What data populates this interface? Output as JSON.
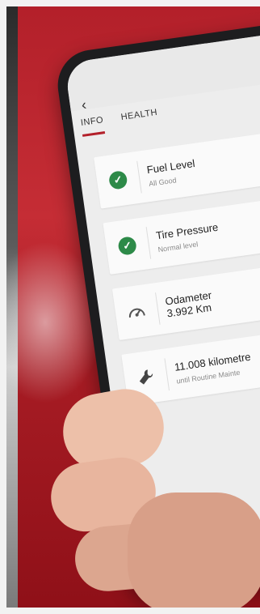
{
  "tabs": [
    {
      "label": "INFO",
      "active": true
    },
    {
      "label": "HEALTH",
      "active": false
    }
  ],
  "cards": [
    {
      "icon": "check-circle-icon",
      "title": "Fuel Level",
      "subtitle": "All Good"
    },
    {
      "icon": "check-circle-icon",
      "title": "Tire Pressure",
      "subtitle": "Normal level"
    },
    {
      "icon": "speedometer-icon",
      "title": "Odameter",
      "subtitle": "3.992 Km"
    },
    {
      "icon": "wrench-icon",
      "title": "11.008 kilometre",
      "subtitle": "until Routine Mainte"
    }
  ],
  "colors": {
    "accent": "#b3202a",
    "ok": "#2d8a48"
  }
}
